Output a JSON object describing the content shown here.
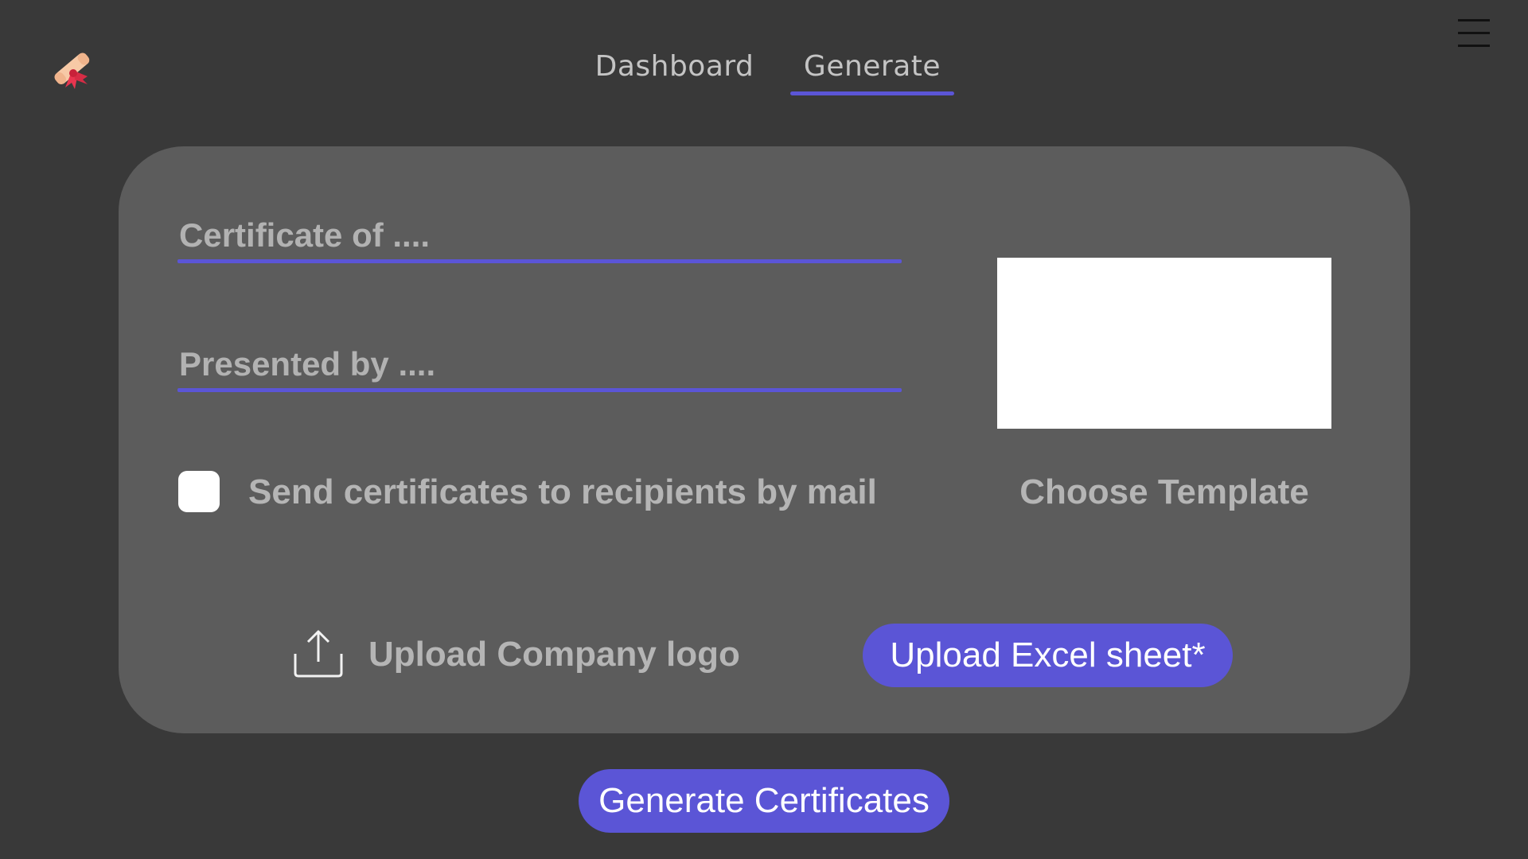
{
  "nav": {
    "tabs": [
      {
        "label": "Dashboard",
        "active": false
      },
      {
        "label": "Generate",
        "active": true
      }
    ]
  },
  "icons": {
    "logo": "certificate-scroll-icon",
    "menu": "hamburger-menu-icon",
    "upload": "upload-icon"
  },
  "colors": {
    "background": "#393939",
    "card": "#5c5c5c",
    "accent": "#5b55d6",
    "text_muted": "#b5b5b5"
  },
  "form": {
    "certificate_of_placeholder": "Certificate of ....",
    "presented_by_placeholder": "Presented by ....",
    "send_mail_label": "Send certificates to recipients by mail",
    "send_mail_checked": false,
    "choose_template_label": "Choose Template",
    "upload_logo_label": "Upload Company logo",
    "upload_excel_label": "Upload Excel sheet*"
  },
  "actions": {
    "generate_label": "Generate Certificates"
  }
}
